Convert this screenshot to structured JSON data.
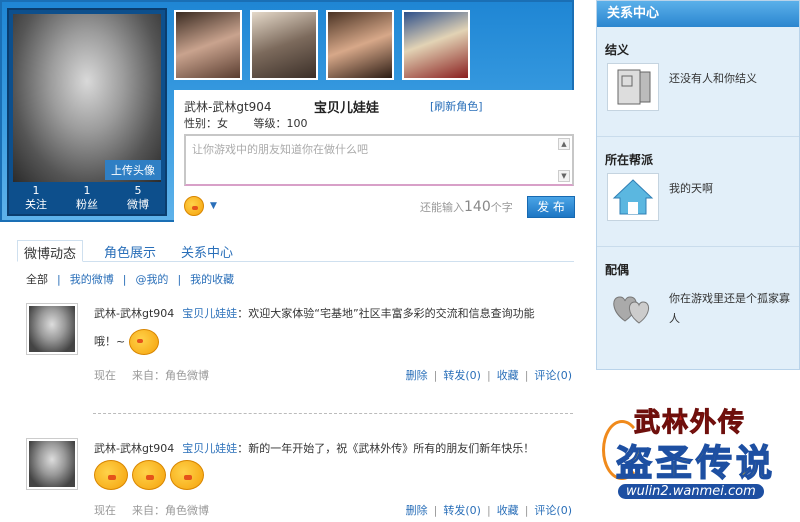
{
  "profile": {
    "upload_label": "上传头像",
    "stats": [
      {
        "count": "1",
        "label": "关注"
      },
      {
        "count": "1",
        "label": "粉丝"
      },
      {
        "count": "5",
        "label": "微博"
      }
    ],
    "role_name": "武林-武林gt904",
    "nickname": "宝贝儿娃娃",
    "refresh_label": "[刷新角色]",
    "gender": "性别：女",
    "level": "等级：100"
  },
  "composer": {
    "placeholder": "让你游戏中的朋友知道你在做什么吧",
    "counter_prefix": "还能输入",
    "counter_value": "140",
    "counter_suffix": "个字",
    "publish_label": "发 布"
  },
  "tabs": [
    "微博动态",
    "角色展示",
    "关系中心"
  ],
  "filters": [
    "全部",
    "我的微博",
    "@我的",
    "我的收藏"
  ],
  "posts": [
    {
      "author": "武林-武林gt904",
      "nick": "宝贝儿娃娃",
      "text": "：欢迎大家体验“宅基地”社区丰富多彩的交流和信息查询功能",
      "text2": "哦！~",
      "time": "现在",
      "from": "来自：角色微博",
      "actions": [
        "删除",
        "转发(0)",
        "收藏",
        "评论(0)"
      ]
    },
    {
      "author": "武林-武林gt904",
      "nick": "宝贝儿娃娃",
      "text": "：新的一年开始了，祝《武林外传》所有的朋友们新年快乐！",
      "time": "现在",
      "from": "来自：角色微博",
      "actions": [
        "删除",
        "转发(0)",
        "收藏",
        "评论(0)"
      ]
    }
  ],
  "sidebar": {
    "title": "关系中心",
    "sections": [
      {
        "title": "结义",
        "text": "还没有人和你结义",
        "icon": "scroll-icon"
      },
      {
        "title": "所在帮派",
        "text": "我的天啊",
        "icon": "house-icon"
      },
      {
        "title": "配偶",
        "text": "你在游戏里还是个孤家寡人",
        "icon": "hearts-icon"
      }
    ]
  },
  "logo": {
    "line1": "武林外传",
    "line2": "盗圣传说",
    "line3": "wulin2.wanmei.com"
  }
}
